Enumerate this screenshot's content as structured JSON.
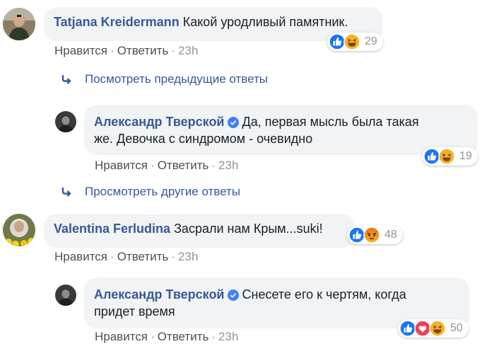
{
  "comments": [
    {
      "author": "Tatjana Kreidermann",
      "text": "Какой уродливый памятник.",
      "like": "Нравится",
      "reply": "Ответить",
      "time": "23h",
      "reactions": [
        "like",
        "haha"
      ],
      "reaction_count": "29"
    },
    {
      "view_replies": "Посмотреть предыдущие ответы"
    },
    {
      "author": "Александр Тверской",
      "verified": true,
      "text_line1": "Да, первая мысль была такая",
      "text_line2": "же. Девочка с синдромом - очевидно",
      "like": "Нравится",
      "reply": "Ответить",
      "time": "23h",
      "reactions": [
        "like",
        "haha"
      ],
      "reaction_count": "19"
    },
    {
      "view_replies": "Просмотреть другие ответы"
    },
    {
      "author": "Valentina Ferludina",
      "text": "Засрали нам Крым...suki!",
      "like": "Нравится",
      "reply": "Ответить",
      "time": "23h",
      "reactions": [
        "like",
        "angry"
      ],
      "reaction_count": "48"
    },
    {
      "author": "Александр Тверской",
      "verified": true,
      "text_line1": "Снесете его к чертям, когда",
      "text_line2": "придет время",
      "like": "Нравится",
      "reply": "Ответить",
      "time": "23h",
      "reactions": [
        "like",
        "love",
        "haha"
      ],
      "reaction_count": "50"
    }
  ],
  "colors": {
    "link": "#385898",
    "bubble": "#f2f3f5",
    "meta": "#90949c",
    "like_blue": "#1877f2",
    "love_red": "#f33e58",
    "haha_yellow": "#f7b125",
    "verified_blue": "#4080ff"
  }
}
